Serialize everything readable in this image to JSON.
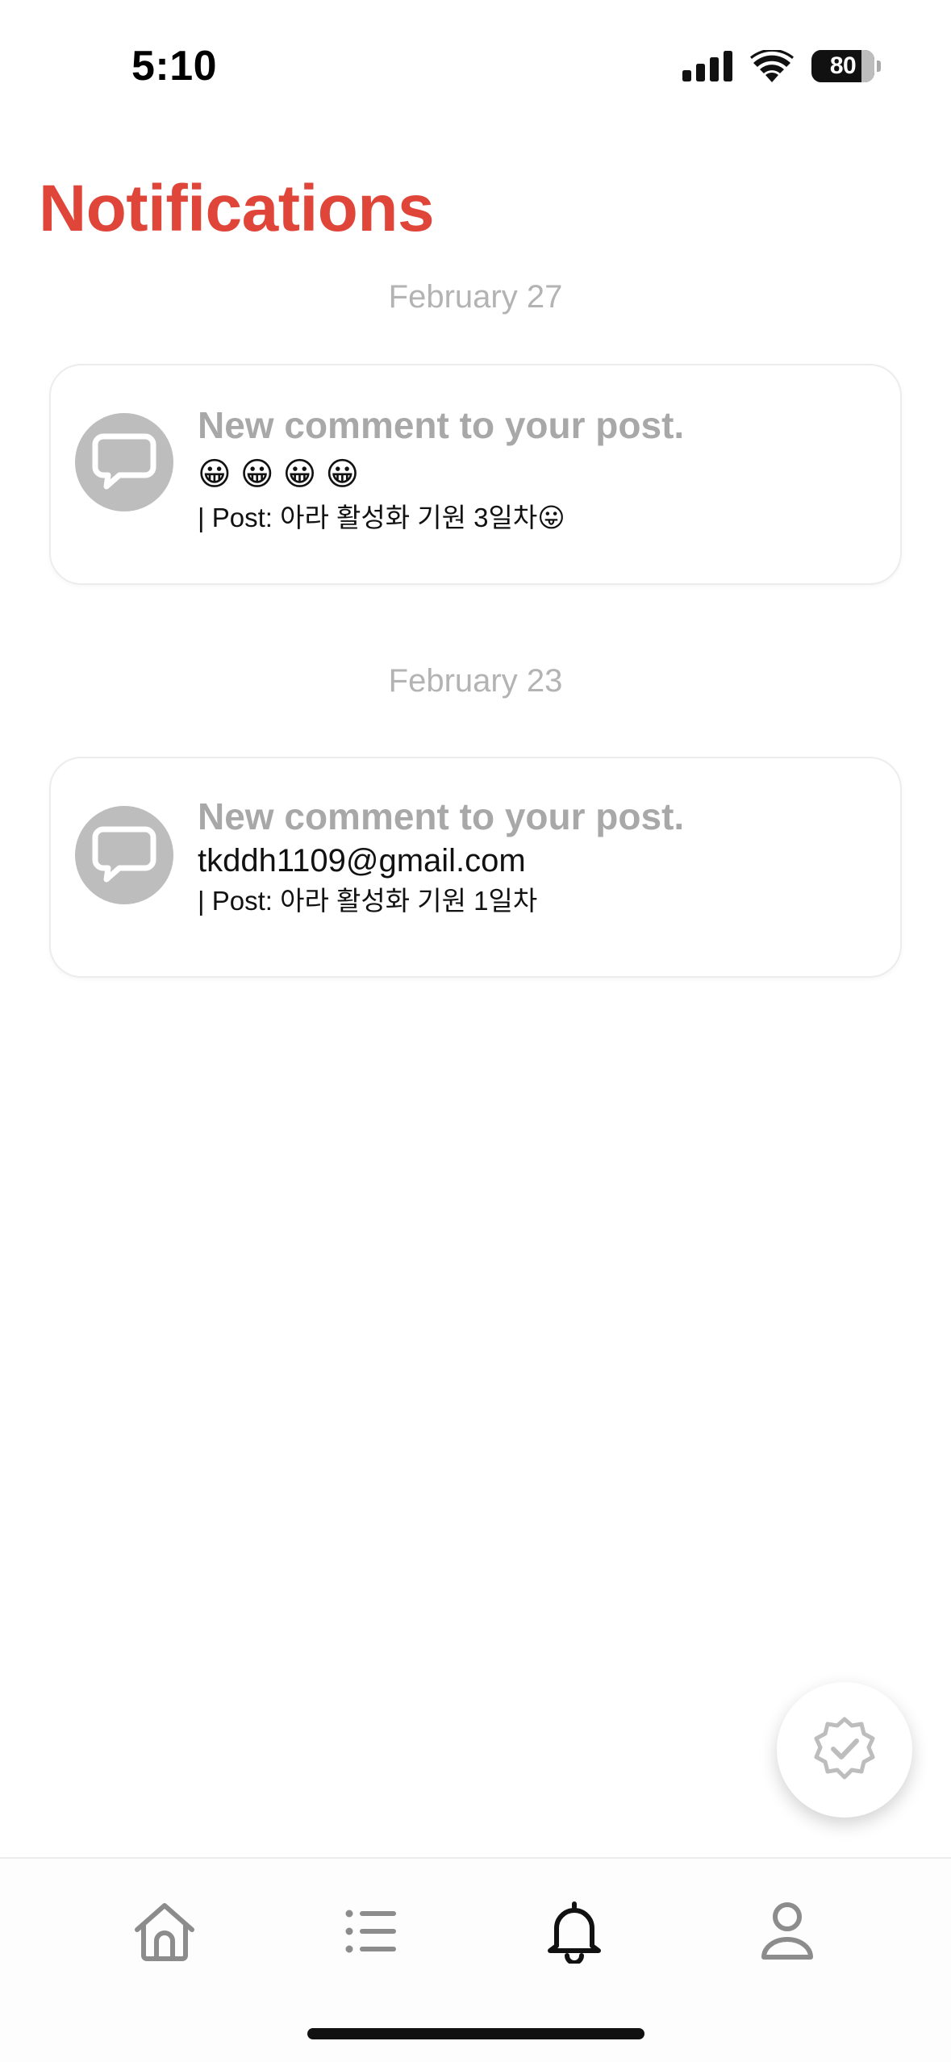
{
  "status_bar": {
    "time": "5:10",
    "battery": "80",
    "icons": [
      "signal-icon",
      "wifi-icon",
      "battery-icon"
    ]
  },
  "header": {
    "title": "Notifications"
  },
  "groups": [
    {
      "date": "February 27",
      "notifications": [
        {
          "icon": "chat-bubble-icon",
          "heading": "New comment to your post.",
          "body": "😀 😀 😀 😀",
          "post": "| Post: 아라 활성화 기원 3일차😛"
        }
      ]
    },
    {
      "date": "February 23",
      "notifications": [
        {
          "icon": "chat-bubble-icon",
          "heading": "New comment to your post.",
          "body": "tkddh1109@gmail.com",
          "post": "| Post: 아라 활성화 기원 1일차"
        }
      ]
    }
  ],
  "fab": {
    "icon": "verified-badge-icon"
  },
  "tab_bar": {
    "items": [
      {
        "icon": "home-icon",
        "active": false
      },
      {
        "icon": "list-icon",
        "active": false
      },
      {
        "icon": "bell-icon",
        "active": true
      },
      {
        "icon": "profile-icon",
        "active": false
      }
    ]
  },
  "colors": {
    "accent": "#e0453a",
    "muted_text": "#a8a8a8",
    "date_text": "#b3b3b3",
    "avatar_bg": "#bdbdbd",
    "inactive_icon": "#8c8c8c",
    "active_icon": "#111111"
  }
}
